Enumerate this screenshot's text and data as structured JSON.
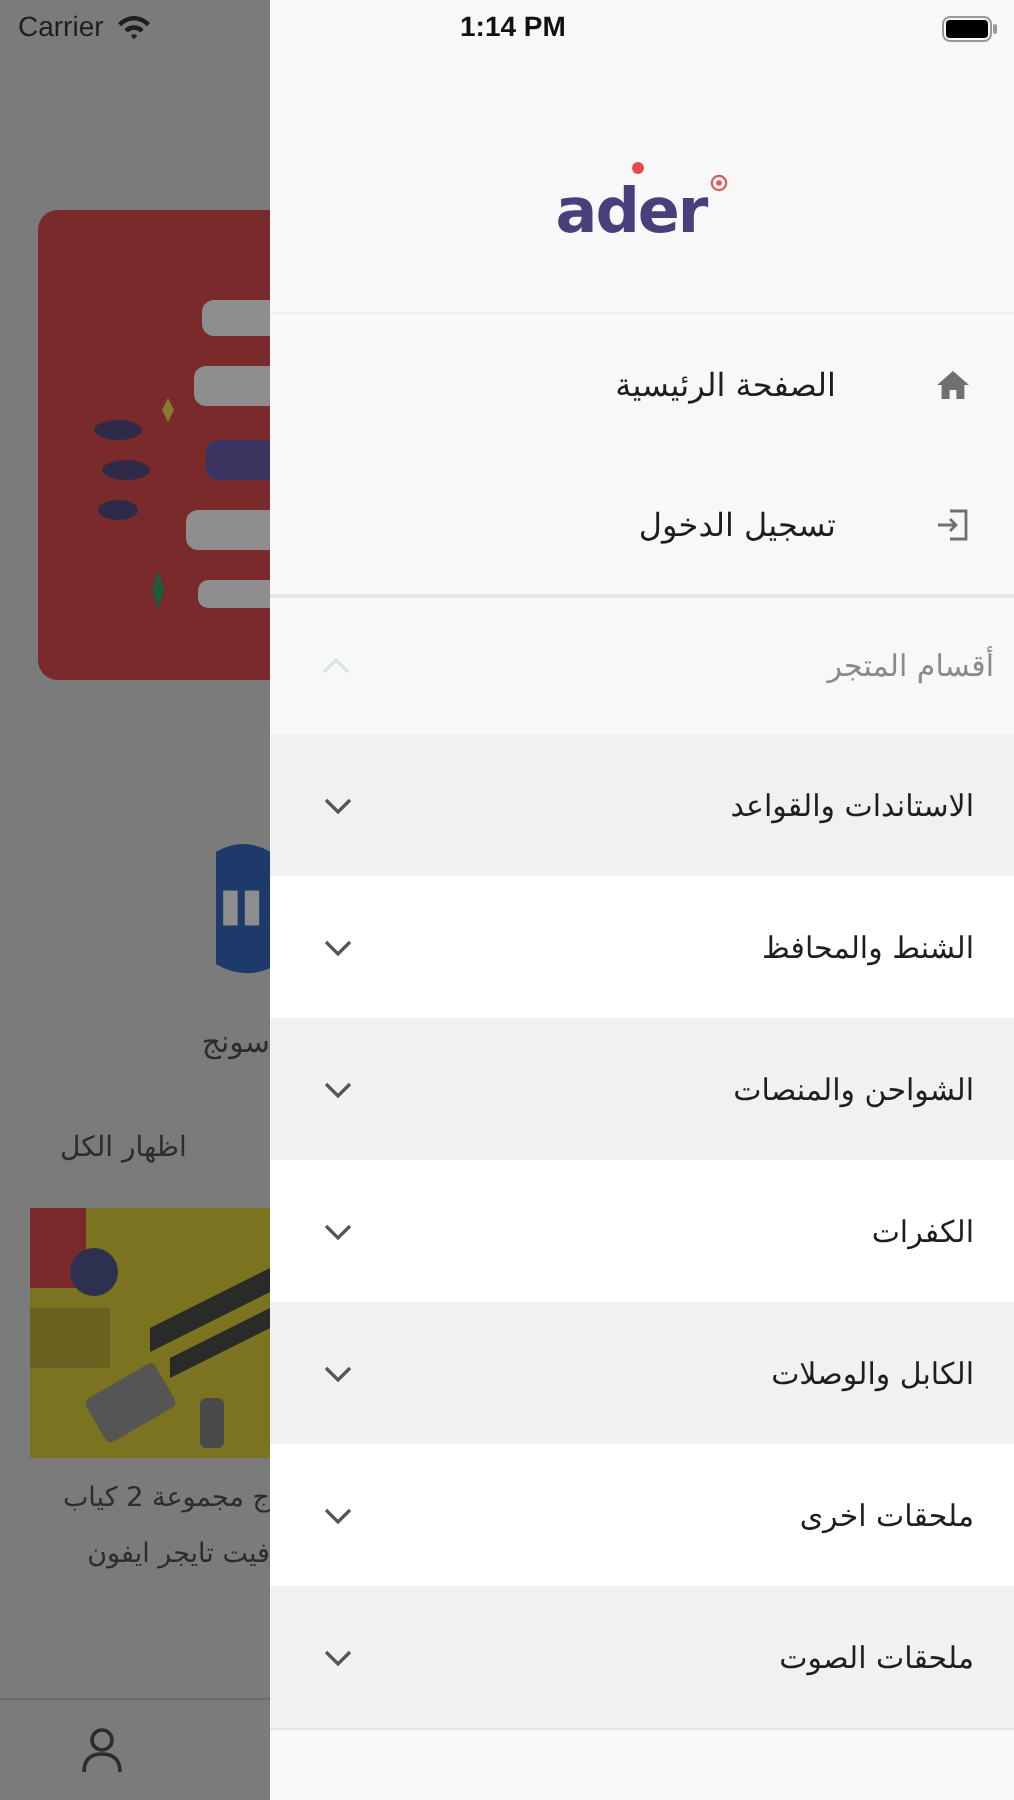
{
  "status_bar": {
    "carrier": "Carrier",
    "time": "1:14 PM"
  },
  "background_screen": {
    "brand_name": "سونج",
    "show_all_link": "اظهار الكل",
    "product_title_lines": [
      "ج مجموعة 2 كياب",
      "فيت تايجر ايفون"
    ]
  },
  "drawer": {
    "logo_text": "ader",
    "menu_items": [
      {
        "kind": "home",
        "label": "الصفحة الرئيسية"
      },
      {
        "kind": "login",
        "label": "تسجيل الدخول"
      }
    ],
    "categories_section": {
      "title": "أقسام المتجر",
      "expanded": true,
      "items": [
        {
          "label": "الاستاندات والقواعد",
          "expanded": false
        },
        {
          "label": "الشنط والمحافظ",
          "expanded": false
        },
        {
          "label": "الشواحن والمنصات",
          "expanded": false
        },
        {
          "label": "الكفرات",
          "expanded": false
        },
        {
          "label": "الكابل والوصلات",
          "expanded": false
        },
        {
          "label": "ملحقات اخرى",
          "expanded": false
        },
        {
          "label": "ملحقات الصوت",
          "expanded": false
        }
      ]
    }
  }
}
